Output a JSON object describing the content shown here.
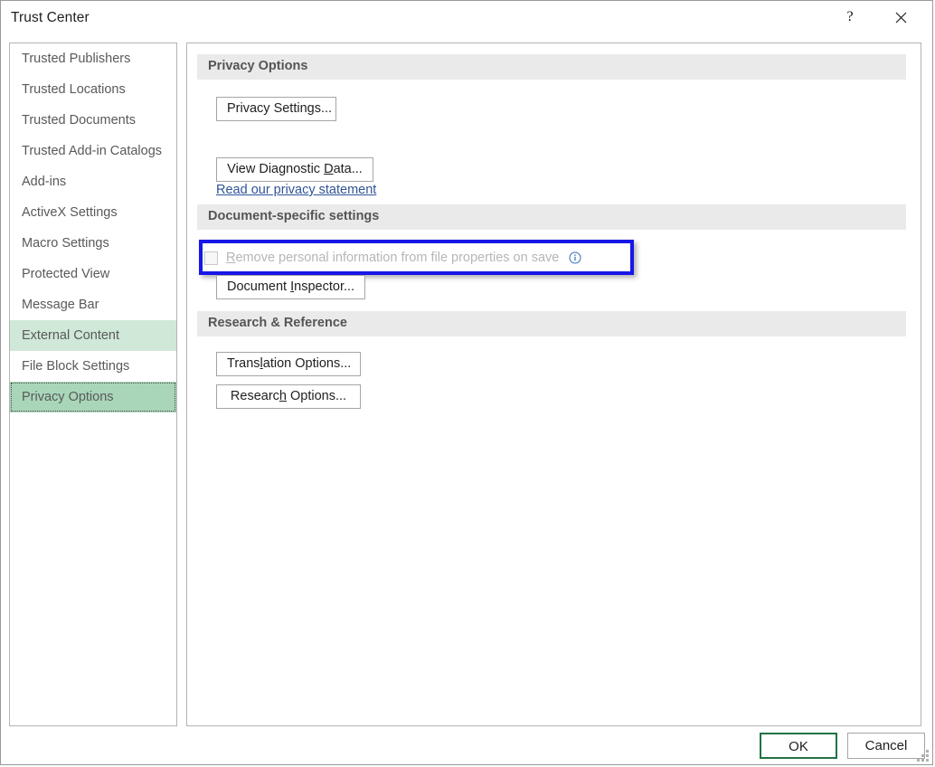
{
  "window": {
    "title": "Trust Center",
    "help_button": "?",
    "close_button": "✕"
  },
  "sidebar": {
    "items": [
      {
        "label": "Trusted Publishers",
        "state": "normal"
      },
      {
        "label": "Trusted Locations",
        "state": "normal"
      },
      {
        "label": "Trusted Documents",
        "state": "normal"
      },
      {
        "label": "Trusted Add-in Catalogs",
        "state": "normal"
      },
      {
        "label": "Add-ins",
        "state": "normal"
      },
      {
        "label": "ActiveX Settings",
        "state": "normal"
      },
      {
        "label": "Macro Settings",
        "state": "normal"
      },
      {
        "label": "Protected View",
        "state": "normal"
      },
      {
        "label": "Message Bar",
        "state": "normal"
      },
      {
        "label": "External Content",
        "state": "hover"
      },
      {
        "label": "File Block Settings",
        "state": "normal"
      },
      {
        "label": "Privacy Options",
        "state": "selected"
      }
    ]
  },
  "main": {
    "sections": [
      {
        "title": "Privacy Options",
        "privacy_settings_button": "Privacy Settings...",
        "privacy_link": "Read our privacy statement",
        "diagnostic_button_pre": "View Diagnostic ",
        "diagnostic_button_acc": "D",
        "diagnostic_button_post": "ata..."
      },
      {
        "title": "Document-specific settings",
        "checkbox_acc": "R",
        "checkbox_label_post": "emove personal information from file properties on save",
        "checkbox_checked": false,
        "checkbox_disabled": true,
        "info_icon": "info-circle-icon",
        "inspector_button_pre": "Document ",
        "inspector_button_acc": "I",
        "inspector_button_post": "nspector..."
      },
      {
        "title": "Research & Reference",
        "translation_button_pre": "Trans",
        "translation_button_acc": "l",
        "translation_button_post": "ation Options...",
        "research_button_pre": "Researc",
        "research_button_acc": "h",
        "research_button_post": " Options..."
      }
    ]
  },
  "footer": {
    "ok_label": "OK",
    "cancel_label": "Cancel"
  },
  "colors": {
    "selected_green": "#a9d6b9",
    "hover_green": "#cfe8d7",
    "highlight_blue": "#1717e8",
    "ok_border_green": "#217346",
    "link_blue": "#2f5496",
    "section_bar_gray": "#eaeaea"
  }
}
